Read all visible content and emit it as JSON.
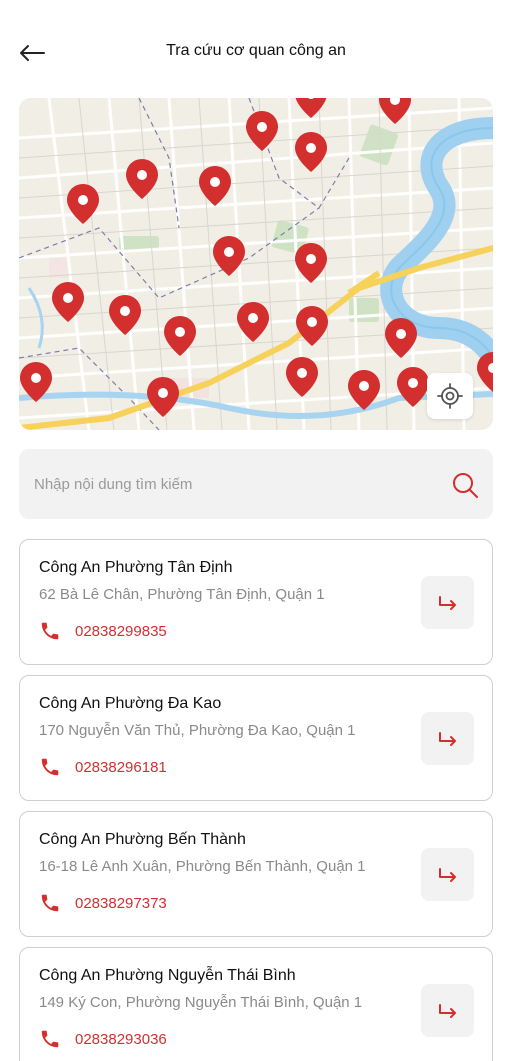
{
  "header": {
    "title": "Tra cứu cơ quan công an",
    "back_icon": "arrow-left-icon"
  },
  "map": {
    "pin_icon": "location-pin-icon",
    "locate_icon": "crosshair-icon",
    "pin_color": "#d32f2f"
  },
  "search": {
    "placeholder": "Nhập nội dung tìm kiếm",
    "value": "",
    "icon": "search-icon",
    "icon_color": "#d32f2f"
  },
  "stations": [
    {
      "name": "Công An Phường Tân Định",
      "address": "62 Bà Lê Chân, Phường Tân Định, Quận 1",
      "phone": "02838299835"
    },
    {
      "name": "Công An Phường Đa Kao",
      "address": "170 Nguyễn Văn Thủ, Phường Đa Kao, Quận 1",
      "phone": "02838296181"
    },
    {
      "name": "Công An Phường Bến Thành",
      "address": "16-18 Lê Anh Xuân, Phường Bến Thành, Quận 1",
      "phone": "02838297373"
    },
    {
      "name": "Công An Phường Nguyễn Thái Bình",
      "address": "149 Ký Con, Phường Nguyễn Thái Bình, Quận 1",
      "phone": "02838293036"
    }
  ],
  "accent_color": "#d32f2f"
}
